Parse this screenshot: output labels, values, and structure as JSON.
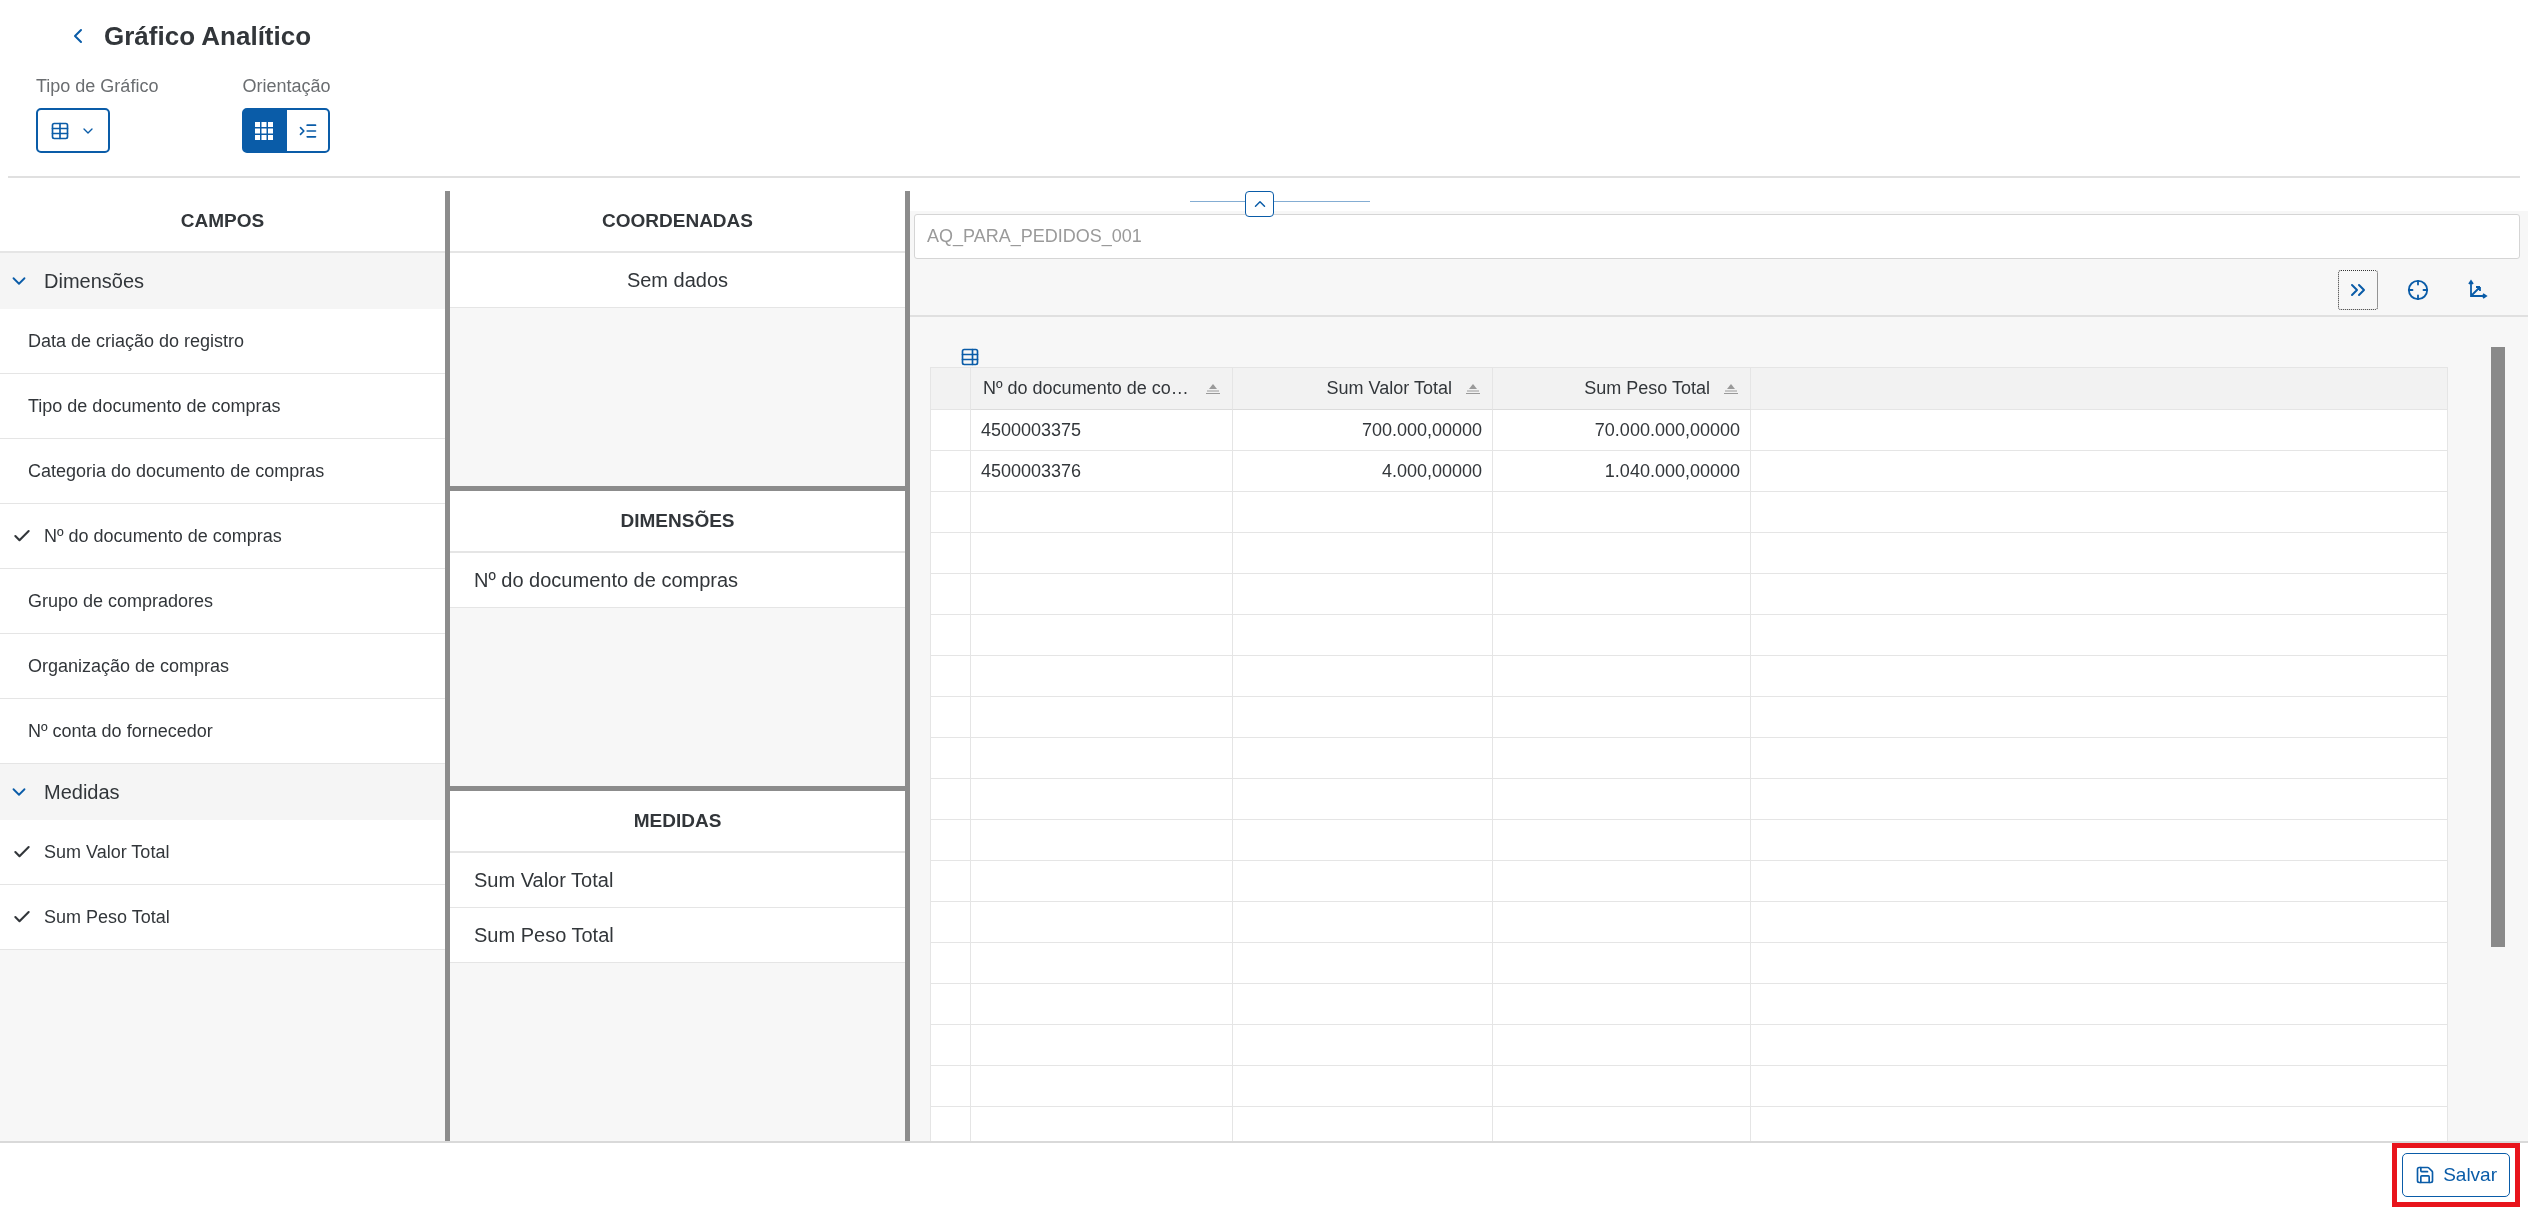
{
  "page": {
    "title": "Gráfico Analítico"
  },
  "controls": {
    "chart_type": {
      "label": "Tipo de Gráfico"
    },
    "orientation": {
      "label": "Orientação",
      "options": [
        {
          "kind": "grid",
          "selected": true
        },
        {
          "kind": "indent",
          "selected": false
        }
      ]
    }
  },
  "fields_panel": {
    "title": "CAMPOS",
    "groups": [
      {
        "label": "Dimensões",
        "expanded": true,
        "items": [
          {
            "label": "Data de criação do registro",
            "checked": false
          },
          {
            "label": "Tipo de documento de compras",
            "checked": false
          },
          {
            "label": "Categoria do documento de compras",
            "checked": false
          },
          {
            "label": "Nº do documento de compras",
            "checked": true
          },
          {
            "label": "Grupo de compradores",
            "checked": false
          },
          {
            "label": "Organização de compras",
            "checked": false
          },
          {
            "label": "Nº conta do fornecedor",
            "checked": false
          }
        ]
      },
      {
        "label": "Medidas",
        "expanded": true,
        "items": [
          {
            "label": "Sum Valor Total",
            "checked": true
          },
          {
            "label": "Sum Peso Total",
            "checked": true
          }
        ]
      }
    ]
  },
  "coordinates": {
    "title": "COORDENADAS",
    "empty_text": "Sem dados"
  },
  "dimensions": {
    "title": "DIMENSÕES",
    "items": [
      "Nº do documento de compras"
    ]
  },
  "measures": {
    "title": "MEDIDAS",
    "items": [
      "Sum Valor Total",
      "Sum Peso Total"
    ]
  },
  "query": {
    "value": "AQ_PARA_PEDIDOS_001"
  },
  "toolbar": {
    "buttons": [
      {
        "kind": "expand",
        "focused": true
      },
      {
        "kind": "target",
        "focused": false
      },
      {
        "kind": "axes",
        "focused": false
      }
    ]
  },
  "table": {
    "columns": [
      {
        "label": "Nº do documento de co…"
      },
      {
        "label": "Sum Valor Total"
      },
      {
        "label": "Sum Peso Total"
      }
    ],
    "rows": [
      [
        "4500003375",
        "700.000,00000",
        "70.000.000,00000"
      ],
      [
        "4500003376",
        "4.000,00000",
        "1.040.000,00000"
      ]
    ]
  },
  "footer": {
    "save": {
      "label": "Salvar",
      "highlighted": true
    }
  }
}
